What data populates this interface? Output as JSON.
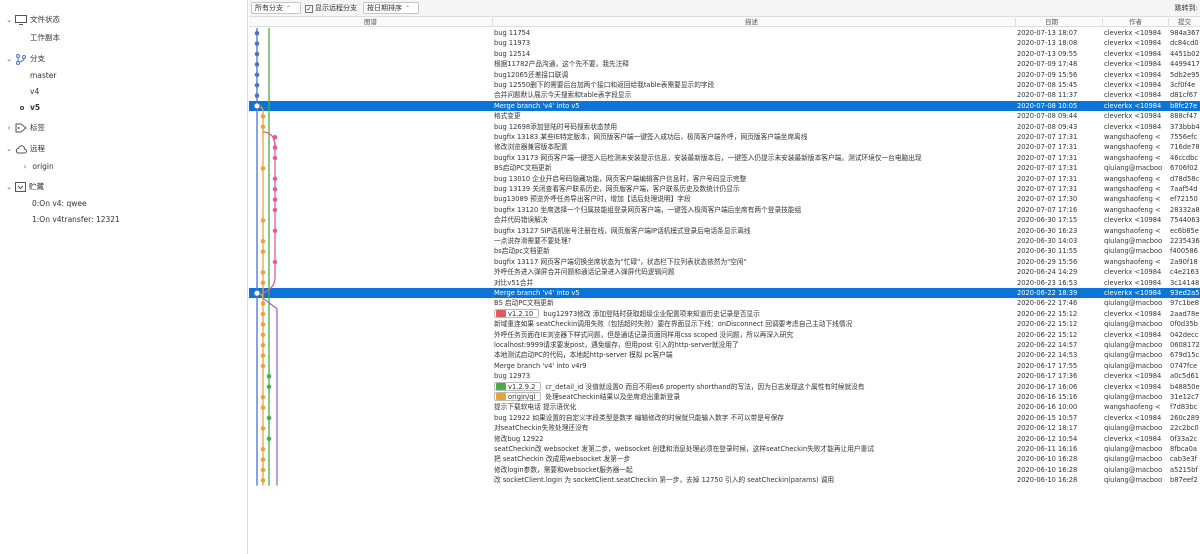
{
  "sidebar": {
    "workspace_label": "文件状态",
    "workspace_item": "工作副本",
    "branches_label": "分支",
    "branches": [
      "master",
      "v4",
      "v5"
    ],
    "current_branch": "v5",
    "tags_label": "标签",
    "remotes_label": "远程",
    "remote_item": "origin",
    "stash_label": "贮藏",
    "stashes": [
      "0:On v4: qwee",
      "1:On v4transfer: 12321"
    ]
  },
  "toolbar": {
    "branch_filter": "所有分支",
    "show_remote_label": "显示远程分支",
    "show_remote_checked": true,
    "sort_order": "按日期排序",
    "jump_label": "跳转到:"
  },
  "columns": {
    "graph": "图谱",
    "description": "描述",
    "date": "日期",
    "author": "作者",
    "commit": "提交"
  },
  "colors": {
    "selection": "#0a74d8",
    "graph_blue": "#4a73c8",
    "graph_green": "#4cab47",
    "graph_orange": "#e8a33a",
    "graph_pink": "#e05c9a",
    "graph_purple": "#9b6bd1"
  },
  "commits": [
    {
      "desc": "bug 11754",
      "date": "2020-07-13 18:07",
      "author": "cleverkx <10984",
      "hash": "984a367"
    },
    {
      "desc": "bug  11973",
      "date": "2020-07-13 18:08",
      "author": "cleverkx <10984",
      "hash": "dc84cd0"
    },
    {
      "desc": "bug 12514",
      "date": "2020-07-13 09:55",
      "author": "cleverkx <10984",
      "hash": "4451b02"
    },
    {
      "desc": "根据11782产品沟通，这个先不要，我先注释",
      "date": "2020-07-09 17:48",
      "author": "cleverkx <10984",
      "hash": "4499417"
    },
    {
      "desc": "bug12065还差接口联调",
      "date": "2020-07-09 15:56",
      "author": "cleverkx <10984",
      "hash": "5db2e95"
    },
    {
      "desc": "bug 12550删下的需要后台加两个接口和返回给我table表需要显示的字段",
      "date": "2020-07-08 15:45",
      "author": "cleverkx <10984",
      "hash": "3cf0f4e"
    },
    {
      "desc": "合并问题默认展示今天搜索和table表字段显示",
      "date": "2020-07-08 11:37",
      "author": "cleverkx <10984",
      "hash": "d81cf67"
    },
    {
      "desc": "Merge branch 'v4' into v5",
      "date": "2020-07-08 10:05",
      "author": "cleverkx <10984",
      "hash": "b8fc27e",
      "selected": true
    },
    {
      "desc": "格式变更",
      "date": "2020-07-08 09:44",
      "author": "cleverkx <10984",
      "hash": "888cf47"
    },
    {
      "desc": "bug 12698添加登陆时号码搜索状态禁用",
      "date": "2020-07-08 09:43",
      "author": "cleverkx <10984",
      "hash": "373bbb4"
    },
    {
      "desc": "bugfix 13183 某些IE特定版本，网页版客户端一键签入成功后，极简客户端外呼，网页版客户端坐席离线",
      "date": "2020-07-07 17:31",
      "author": "wangshaofeng <",
      "hash": "7556efc"
    },
    {
      "desc": "修改浏览器兼容版本配置",
      "date": "2020-07-07 17:31",
      "author": "wangshaofeng <",
      "hash": "716de78"
    },
    {
      "desc": "bugfix 13173 网页客户端一键签入后检测未安装提示信息，安装最新版本后，一键签入仍提示未安装最新版本客户端。测试环境仅一台电脑出现",
      "date": "2020-07-07 17:31",
      "author": "wangshaofeng <",
      "hash": "46ccdbc"
    },
    {
      "desc": "BS启动PC文档更新",
      "date": "2020-07-07 17:31",
      "author": "qiulang@macboo",
      "hash": "6706f02"
    },
    {
      "desc": "bug 13010 企业开启号码隐藏功能，网页客户端编辑客户信息时，客户号码显示完整",
      "date": "2020-07-07 17:31",
      "author": "wangshaofeng <",
      "hash": "d78d58c"
    },
    {
      "desc": "bug 13139  关闭查看客户联系历史，网页版客户端，客户联系历史及数统计仍显示",
      "date": "2020-07-07 17:31",
      "author": "wangshaofeng <",
      "hash": "7aaf54d"
    },
    {
      "desc": "bug13089 预览外呼任务导出客户时，增加【话后处理说明】字段",
      "date": "2020-07-07 17:30",
      "author": "wangshaofeng <",
      "hash": "ef72150"
    },
    {
      "desc": "bugfix 13120  坐席选择一个归属技能组登录网页客户端，一键签入极简客户端后坐席有两个登录技能组",
      "date": "2020-07-07 17:16",
      "author": "wangshaofeng <",
      "hash": "28332a8"
    },
    {
      "desc": "合并代码错误解决",
      "date": "2020-06-30 17:15",
      "author": "cleverkx <10984",
      "hash": "7544063"
    },
    {
      "desc": "bugfix 13127 SIP话机账号注册在线，网页版客户端IP话机模式登录后电话条显示离线",
      "date": "2020-06-30 16:23",
      "author": "wangshaofeng <",
      "hash": "ec6b85e"
    },
    {
      "desc": "一点说存滑需要不要处理?",
      "date": "2020-06-30 14:03",
      "author": "qiulang@macboo",
      "hash": "2235436"
    },
    {
      "desc": "bs启动pc文档更新",
      "date": "2020-06-30 11:55",
      "author": "qiulang@macboo",
      "hash": "f400586"
    },
    {
      "desc": "bugfix 13117 网页客户端切换坐席状态为\"忙碌\"，状态栏下拉列表状态依然为\"空闲\"",
      "date": "2020-06-29 15:56",
      "author": "wangshaofeng <",
      "hash": "2a90f18"
    },
    {
      "desc": "外呼任务进入弹屏合并问题和通话记录进入弹屏代码逻辑问题",
      "date": "2020-06-24 14:29",
      "author": "cleverkx <10984",
      "hash": "c4e2163"
    },
    {
      "desc": "对比v51合并",
      "date": "2020-06-23 16:53",
      "author": "cleverkx <10984",
      "hash": "3c14148"
    },
    {
      "desc": "Merge branch 'v4' into v5",
      "date": "2020-06-22 18:39",
      "author": "cleverkx <10984",
      "hash": "93ed2a5",
      "selected": true
    },
    {
      "desc": "BS 启动PC文档更新",
      "date": "2020-06-22 17:46",
      "author": "qiulang@macboo",
      "hash": "97c1be8"
    },
    {
      "desc": "bug12973修改  添加登陆时获取超级企业配置项来知道历史记录是否显示",
      "tag": "v1.2.10",
      "tag_color": "#e05c5c",
      "date": "2020-06-22 15:12",
      "author": "cleverkx <10984",
      "hash": "2aad78e"
    },
    {
      "desc": "新域重连如果 seatCheckin调用失败（包括超时失败）要在界面显示下线：onDisconnect 回调要考虑自己主动下线情况",
      "date": "2020-06-22 15:12",
      "author": "qiulang@macboo",
      "hash": "0f0d35b"
    },
    {
      "desc": "外呼任务页面在IE浏览器下样式问题，但是通话记录页面同样用css scoped 没问题，所以再深入研究",
      "date": "2020-06-22 15:12",
      "author": "cleverkx <10984",
      "hash": "042decc"
    },
    {
      "desc": "localhost:9999请求要发post，遇免缓存，但用post 引入的http-server就没用了",
      "date": "2020-06-22 14:57",
      "author": "qiulang@macboo",
      "hash": "0608172"
    },
    {
      "desc": "本地测试启动PC的代码，本地起http-server 模拟 pc客户端",
      "date": "2020-06-22 14:53",
      "author": "qiulang@macboo",
      "hash": "679d15c"
    },
    {
      "desc": "Merge branch 'v4' into v4r9",
      "date": "2020-06-17 17:55",
      "author": "qiulang@macboo",
      "hash": "0747fce"
    },
    {
      "desc": "bug 12973",
      "date": "2020-06-17 17:36",
      "author": "cleverkx <10984",
      "hash": "a0c5d61"
    },
    {
      "desc": "cr_detail_id 没值就设置0 而且不用es6 property shorthand的写法，因为日志发现这个属性有时候就没有",
      "tag": "v1.2.9.2",
      "tag_color": "#4cab47",
      "date": "2020-06-17 16:06",
      "author": "cleverkx <10984",
      "hash": "b48850e"
    },
    {
      "desc": "处理seatCheckin结果以及坐席退出重新登录",
      "tag": "origin/ql",
      "tag_color": "#e8a33a",
      "date": "2020-06-16 15:16",
      "author": "qiulang@macboo",
      "hash": "31e12c7"
    },
    {
      "desc": "提示下载软电话  提示语优化",
      "date": "2020-06-16 10:00",
      "author": "wangshaofeng <",
      "hash": "f7d83bc"
    },
    {
      "desc": "bug 12922 如果设置的自定义字段类型是数字   编辑修改的时候就只能输入数字  不可以带是号保存",
      "date": "2020-06-15 10:57",
      "author": "cleverkx <10984",
      "hash": "260c289"
    },
    {
      "desc": "对seatCheckin失败处理还没有",
      "date": "2020-06-12 18:17",
      "author": "qiulang@macboo",
      "hash": "22c2bc0"
    },
    {
      "desc": "修改bug 12922",
      "date": "2020-06-12 10:54",
      "author": "cleverkx <10984",
      "hash": "0f33a2c"
    },
    {
      "desc": "seatCheckin改 websocket 发第二步，websocket 创建和消息处理必须在登录时候，这样seatCheckin失败才能再让用户重试",
      "date": "2020-06-11 16:16",
      "author": "qiulang@macboo",
      "hash": "8fbca0a"
    },
    {
      "desc": "把 seatCheckin 改成用websocket 发第一步",
      "date": "2020-06-10 16:28",
      "author": "qiulang@macboo",
      "hash": "cab3e3f"
    },
    {
      "desc": "修改login参数，需要和websocket服务器一起",
      "date": "2020-06-10 16:28",
      "author": "qiulang@macboo",
      "hash": "a5215bf"
    },
    {
      "desc": "改 socketClient.login 为 socketClient.seatCheckin 第一步，去掉 12750 引入的 seatCheckin(params) 调用",
      "date": "2020-06-10 16:28",
      "author": "qiulang@macboo",
      "hash": "b87eef2"
    }
  ]
}
